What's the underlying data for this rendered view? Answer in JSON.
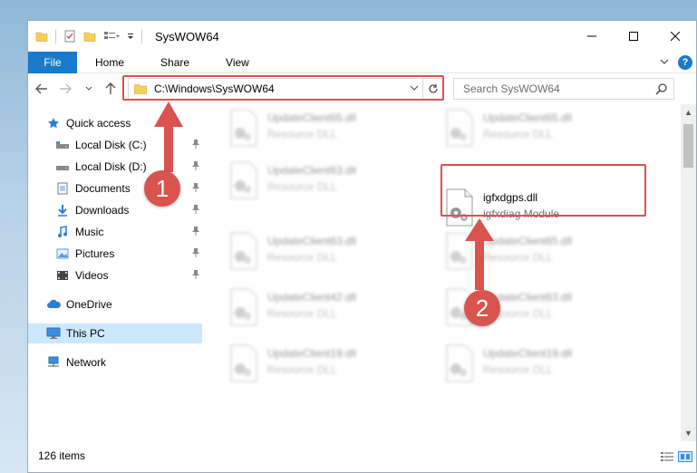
{
  "window": {
    "title": "SysWOW64"
  },
  "ribbon": {
    "tabs": [
      "File",
      "Home",
      "Share",
      "View"
    ],
    "help": "?"
  },
  "address": {
    "path": "C:\\Windows\\SysWOW64"
  },
  "search": {
    "placeholder": "Search SysWOW64"
  },
  "sidebar": {
    "items": [
      {
        "label": "Quick access",
        "icon": "star-icon"
      },
      {
        "label": "Local Disk (C:)",
        "icon": "drive-icon",
        "pinned": true
      },
      {
        "label": "Local Disk (D:)",
        "icon": "drive-icon",
        "pinned": true
      },
      {
        "label": "Documents",
        "icon": "documents-icon",
        "pinned": true
      },
      {
        "label": "Downloads",
        "icon": "download-icon",
        "pinned": true
      },
      {
        "label": "Music",
        "icon": "music-icon",
        "pinned": true
      },
      {
        "label": "Pictures",
        "icon": "pictures-icon",
        "pinned": true
      },
      {
        "label": "Videos",
        "icon": "videos-icon",
        "pinned": true
      },
      {
        "label": "OneDrive",
        "icon": "cloud-icon"
      },
      {
        "label": "This PC",
        "icon": "computer-icon",
        "selected": true
      },
      {
        "label": "Network",
        "icon": "network-icon"
      }
    ]
  },
  "files": [
    {
      "name": "UpdateClient65.dll",
      "type": "Resource DLL"
    },
    {
      "name": "UpdateClient65.dll",
      "type": "Resource DLL"
    },
    {
      "name": "UpdateClient63.dll",
      "type": "Resource DLL"
    },
    {
      "name": "igfxdgps.dll",
      "type": "igfxdiag Module"
    },
    {
      "name": "UpdateClient63.dll",
      "type": "Resource DLL"
    },
    {
      "name": "UpdateClient65.dll",
      "type": "Resource DLL"
    },
    {
      "name": "UpdateClient42.dll",
      "type": "Resource DLL"
    },
    {
      "name": "UpdateClient63.dll",
      "type": "Resource DLL"
    },
    {
      "name": "UpdateClient19.dll",
      "type": "Resource DLL"
    },
    {
      "name": "UpdateClient19.dll",
      "type": "Resource DLL"
    }
  ],
  "status": {
    "item_count": "126 items"
  },
  "annotations": {
    "step1": "1",
    "step2": "2",
    "highlight_color": "#d9534f"
  },
  "colors": {
    "accent": "#1979ca",
    "selection": "#cce8ff"
  }
}
